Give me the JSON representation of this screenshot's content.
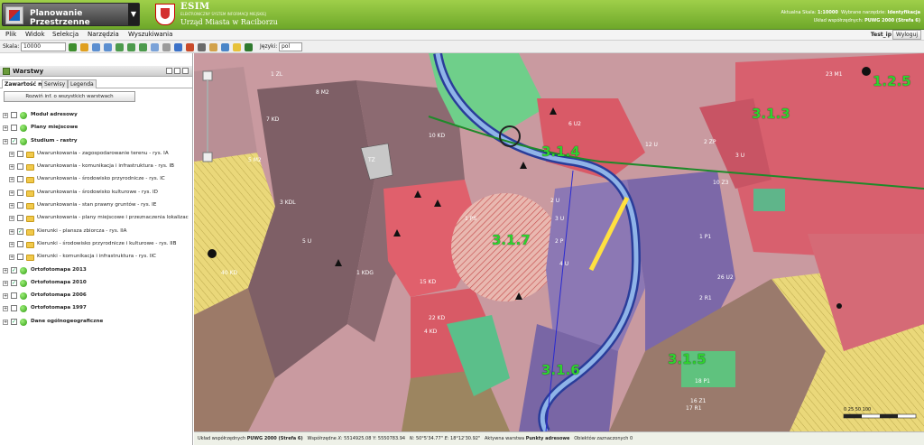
{
  "app": {
    "selector_title": "Planowanie Przestrzenne",
    "brand_title": "ESIM",
    "brand_subtitle": "ELEKTRONICZNY SYSTEM INFORMACJI MIEJSKIEJ",
    "brand_city": "Urząd Miasta w Raciborzu"
  },
  "header_info": {
    "scale_label": "Aktualna Skala:",
    "scale_value": "1:10000",
    "tool_label": "Wybrane narzędzie:",
    "tool_value": "Identyfikacja",
    "crs_label": "Układ współrzędnych:",
    "crs_value": "PUWG 2000 (Strefa 6)"
  },
  "menu": {
    "items": [
      "Plik",
      "Widok",
      "Selekcja",
      "Narzędzia",
      "Wyszukiwania"
    ],
    "user": "Test_ip",
    "logout": "Wyloguj"
  },
  "toolbar": {
    "scale_label": "Skala:",
    "scale_value": "10000",
    "language_label": "Języki:",
    "language_value": "pol"
  },
  "sidebar": {
    "panel_title": "Warstwy",
    "tabs": [
      "Zawartość mapy",
      "Serwisy",
      "Legenda"
    ],
    "expand_button": "Rozwiń inf. o wszystkich warstwach",
    "layers": [
      {
        "label": "Moduł adresowy",
        "bold": true,
        "level": 0
      },
      {
        "label": "Plany miejscowe",
        "bold": true,
        "level": 0
      },
      {
        "label": "Studium - rastry",
        "bold": true,
        "level": 0
      },
      {
        "label": "Uwarunkowania - zagospodarowanie terenu - rys. IA",
        "bold": false,
        "level": 1
      },
      {
        "label": "Uwarunkowania - komunikacja i infrastruktura - rys. IB",
        "bold": false,
        "level": 1
      },
      {
        "label": "Uwarunkowania - środowisko przyrodnicze - rys. IC",
        "bold": false,
        "level": 1
      },
      {
        "label": "Uwarunkowania - środowisko kulturowe - rys. ID",
        "bold": false,
        "level": 1
      },
      {
        "label": "Uwarunkowania - stan prawny gruntów - rys. IE",
        "bold": false,
        "level": 1
      },
      {
        "label": "Uwarunkowania - plany miejscowe i przeznaczenia lokalizac",
        "bold": false,
        "level": 1
      },
      {
        "label": "Kierunki - plansza zbiorcza - rys. IIA",
        "bold": false,
        "level": 1
      },
      {
        "label": "Kierunki - środowisko przyrodnicze i kulturowe - rys. IIB",
        "bold": false,
        "level": 1
      },
      {
        "label": "Kierunki - komunikacja i infrastruktura - rys. IIC",
        "bold": false,
        "level": 1
      },
      {
        "label": "Ortofotomapa 2013",
        "bold": true,
        "level": 0
      },
      {
        "label": "Ortofotomapa 2010",
        "bold": true,
        "level": 0
      },
      {
        "label": "Ortofotomapa 2006",
        "bold": true,
        "level": 0
      },
      {
        "label": "Ortofotomapa 1997",
        "bold": true,
        "level": 0
      },
      {
        "label": "Dane ogólnogeograficzne",
        "bold": true,
        "level": 0
      }
    ]
  },
  "map": {
    "zone_labels": [
      "1.2.5",
      "3.1.3",
      "3.1.4",
      "3.1.7",
      "3.1.6",
      "3.1.5"
    ],
    "parcel_labels": [
      "TZ",
      "1 PS",
      "2 P",
      "2 U",
      "3 U",
      "4 U",
      "5 U",
      "7 KD",
      "10 KD",
      "15 KD",
      "22 KD",
      "40 KD",
      "1 KDG",
      "4 KD",
      "3 KDL",
      "12 U",
      "6 U2",
      "8 M2",
      "5 M2",
      "1 ZL",
      "2 ZP",
      "3 U",
      "10 Z3",
      "17 R1",
      "18 P1",
      "16 Z1",
      "1 P1",
      "23 M1",
      "2 R1",
      "26 U2"
    ],
    "scale_bar": "0  25  50  100"
  },
  "status": {
    "crs_label": "Układ współrzędnych",
    "crs_value": "PUWG 2000 (Strefa 6)",
    "coords_label": "Współrzędne",
    "x_label": "X:",
    "x_value": "5514925.08",
    "y_label": "Y:",
    "y_value": "5550783.94",
    "lat_label": "N:",
    "lat_value": "50°5'34.77\"",
    "lon_label": "E:",
    "lon_value": "18°12'30.92\"",
    "active_layer_label": "Aktywna warstwa",
    "active_layer_value": "Punkty adresowe",
    "selected_label": "Obiektów zaznaczonych",
    "selected_value": "0"
  },
  "colors": {
    "header_green": "#7cb32f",
    "zone_label_green": "#2fd12f",
    "residential": "#8a6a70",
    "service": "#e05a66",
    "green_area": "#6fcf8a",
    "industrial": "#8c78b4",
    "river": "#2a3d9a",
    "agri_yellow": "#e6d66a"
  }
}
